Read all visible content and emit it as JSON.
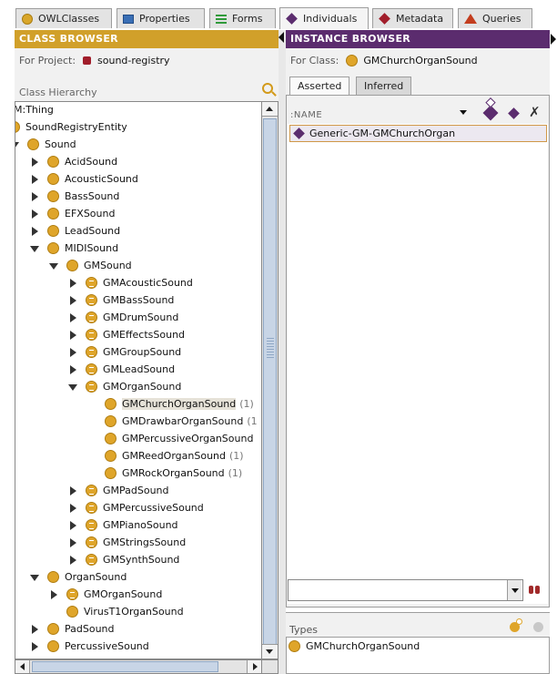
{
  "tabs": [
    {
      "label": "OWLClasses",
      "icon": "owl-classes-icon",
      "active": false
    },
    {
      "label": "Properties",
      "icon": "properties-icon",
      "active": false
    },
    {
      "label": "Forms",
      "icon": "forms-icon",
      "active": false
    },
    {
      "label": "Individuals",
      "icon": "individuals-icon",
      "active": true
    },
    {
      "label": "Metadata",
      "icon": "metadata-icon",
      "active": false
    },
    {
      "label": "Queries",
      "icon": "queries-icon",
      "active": false
    }
  ],
  "class_browser": {
    "title": "CLASS BROWSER",
    "project_label": "For Project:",
    "project_name": "sound-registry",
    "hierarchy_label": "Class Hierarchy",
    "tree": [
      {
        "label": "M:Thing",
        "count": "",
        "toggle": "none",
        "icon": "none",
        "selected": false
      },
      {
        "label": "SoundRegistryEntity",
        "count": "",
        "toggle": "none",
        "icon": "class",
        "selected": false
      },
      {
        "label": "Sound",
        "count": "",
        "toggle": "expanded",
        "icon": "class",
        "selected": false
      },
      {
        "label": "AcidSound",
        "count": "",
        "toggle": "collapsed",
        "icon": "class",
        "selected": false
      },
      {
        "label": "AcousticSound",
        "count": "",
        "toggle": "collapsed",
        "icon": "class",
        "selected": false
      },
      {
        "label": "BassSound",
        "count": "",
        "toggle": "collapsed",
        "icon": "class",
        "selected": false
      },
      {
        "label": "EFXSound",
        "count": "",
        "toggle": "collapsed",
        "icon": "class",
        "selected": false
      },
      {
        "label": "LeadSound",
        "count": "",
        "toggle": "collapsed",
        "icon": "class",
        "selected": false
      },
      {
        "label": "MIDISound",
        "count": "",
        "toggle": "expanded",
        "icon": "class",
        "selected": false
      },
      {
        "label": "GMSound",
        "count": "",
        "toggle": "expanded",
        "icon": "class",
        "selected": false
      },
      {
        "label": "GMAcousticSound",
        "count": "",
        "toggle": "collapsed",
        "icon": "defined",
        "selected": false
      },
      {
        "label": "GMBassSound",
        "count": "",
        "toggle": "collapsed",
        "icon": "defined",
        "selected": false
      },
      {
        "label": "GMDrumSound",
        "count": "",
        "toggle": "collapsed",
        "icon": "defined",
        "selected": false
      },
      {
        "label": "GMEffectsSound",
        "count": "",
        "toggle": "collapsed",
        "icon": "defined",
        "selected": false
      },
      {
        "label": "GMGroupSound",
        "count": "",
        "toggle": "collapsed",
        "icon": "defined",
        "selected": false
      },
      {
        "label": "GMLeadSound",
        "count": "",
        "toggle": "collapsed",
        "icon": "defined",
        "selected": false
      },
      {
        "label": "GMOrganSound",
        "count": "",
        "toggle": "expanded",
        "icon": "defined",
        "selected": false
      },
      {
        "label": "GMChurchOrganSound",
        "count": "(1)",
        "toggle": "none",
        "icon": "class",
        "selected": true
      },
      {
        "label": "GMDrawbarOrganSound",
        "count": "(1",
        "toggle": "none",
        "icon": "class",
        "selected": false
      },
      {
        "label": "GMPercussiveOrganSound",
        "count": "",
        "toggle": "none",
        "icon": "class",
        "selected": false
      },
      {
        "label": "GMReedOrganSound",
        "count": "(1)",
        "toggle": "none",
        "icon": "class",
        "selected": false
      },
      {
        "label": "GMRockOrganSound",
        "count": "(1)",
        "toggle": "none",
        "icon": "class",
        "selected": false
      },
      {
        "label": "GMPadSound",
        "count": "",
        "toggle": "collapsed",
        "icon": "defined",
        "selected": false
      },
      {
        "label": "GMPercussiveSound",
        "count": "",
        "toggle": "collapsed",
        "icon": "defined",
        "selected": false
      },
      {
        "label": "GMPianoSound",
        "count": "",
        "toggle": "collapsed",
        "icon": "defined",
        "selected": false
      },
      {
        "label": "GMStringsSound",
        "count": "",
        "toggle": "collapsed",
        "icon": "defined",
        "selected": false
      },
      {
        "label": "GMSynthSound",
        "count": "",
        "toggle": "collapsed",
        "icon": "defined",
        "selected": false
      },
      {
        "label": "OrganSound",
        "count": "",
        "toggle": "expanded",
        "icon": "class",
        "selected": false
      },
      {
        "label": "GMOrganSound",
        "count": "",
        "toggle": "collapsed",
        "icon": "defined",
        "selected": false
      },
      {
        "label": "VirusT1OrganSound",
        "count": "",
        "toggle": "none",
        "icon": "class",
        "selected": false
      },
      {
        "label": "PadSound",
        "count": "",
        "toggle": "collapsed",
        "icon": "class",
        "selected": false
      },
      {
        "label": "PercussiveSound",
        "count": "",
        "toggle": "collapsed",
        "icon": "class",
        "selected": false
      }
    ]
  },
  "instance_browser": {
    "title": "INSTANCE BROWSER",
    "class_label": "For Class:",
    "class_name": "GMChurchOrganSound",
    "tabs": {
      "asserted": "Asserted",
      "inferred": "Inferred"
    },
    "column_header": ":NAME",
    "instances": [
      "Generic-GM-GMChurchOrgan"
    ],
    "types_label": "Types",
    "types": [
      "GMChurchOrganSound"
    ]
  },
  "colors": {
    "class_browser_header": "#d1a02a",
    "instance_browser_header": "#5b2c6e",
    "class_icon": "#dfa52a",
    "individual_icon": "#5b2c6e"
  }
}
